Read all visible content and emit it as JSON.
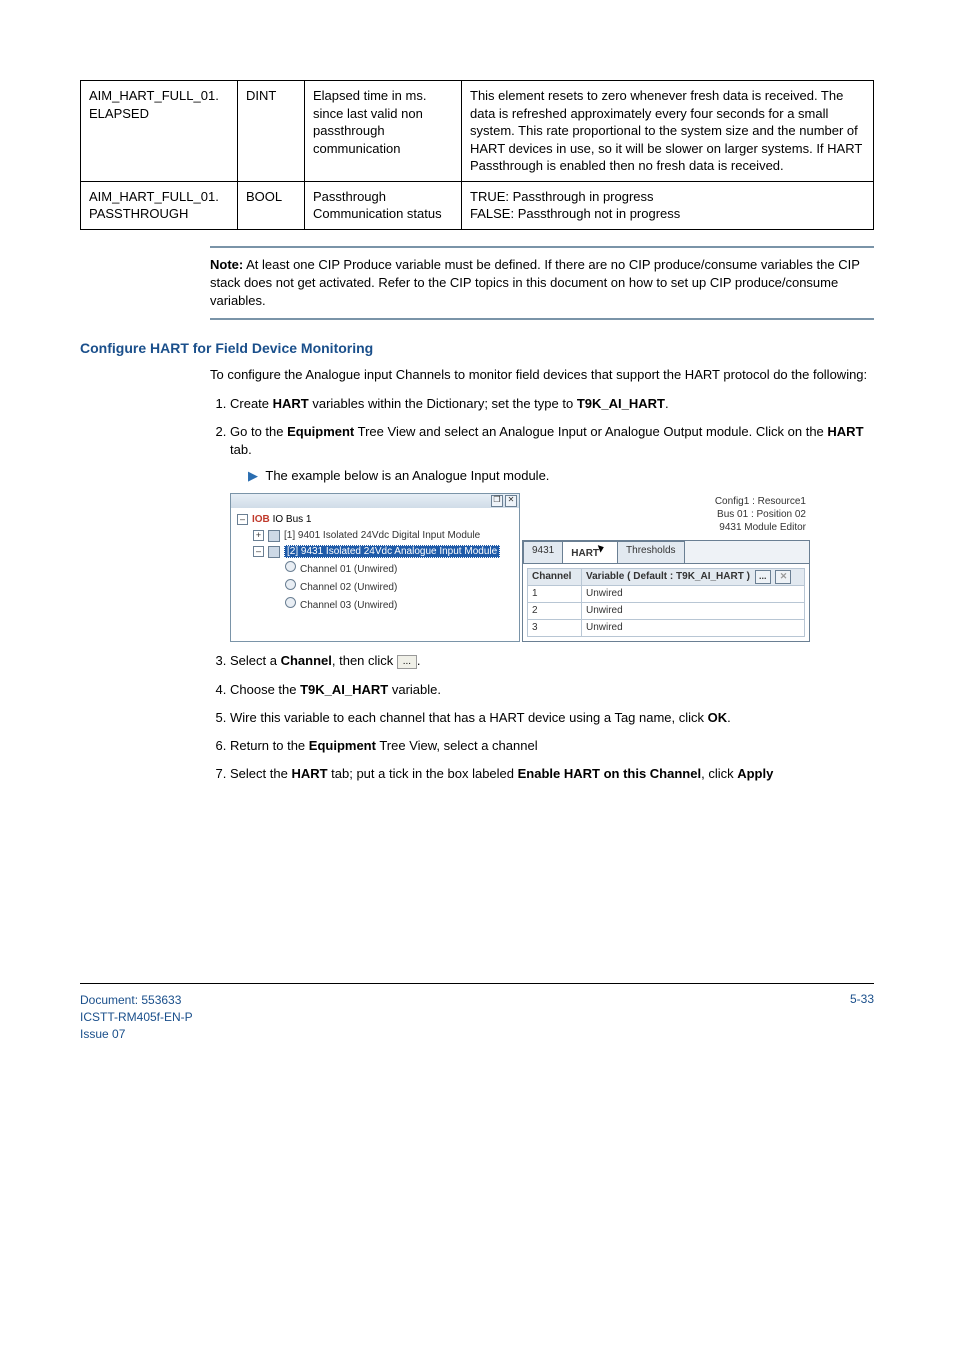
{
  "table": {
    "rows": [
      {
        "name": "AIM_HART_FULL_01.\nELAPSED",
        "type": "DINT",
        "desc": "Elapsed time in ms. since last valid non passthrough communication",
        "detail": "This element resets to zero whenever fresh data is received. The data is refreshed approximately every four seconds for a small system. This rate proportional to the system size and the number of HART devices in use, so it will be slower on larger systems. If HART Passthrough is enabled then no fresh data is received."
      },
      {
        "name": "AIM_HART_FULL_01.\nPASSTHROUGH",
        "type": "BOOL",
        "desc": "Passthrough Communication status",
        "detail": "TRUE: Passthrough in progress\nFALSE: Passthrough not in progress"
      }
    ]
  },
  "note": {
    "label": "Note:",
    "text": " At least one CIP Produce variable must be defined. If there are no CIP produce/consume variables the CIP stack does not get activated. Refer to the CIP topics in this document on how to set up CIP produce/consume variables."
  },
  "section_heading": "Configure HART for Field Device Monitoring",
  "para1": "To configure the Analogue input Channels to monitor field devices that support the HART protocol do the following:",
  "steps12": [
    "Create <b>HART</b> variables within the Dictionary; set the type to <b>T9K_AI_HART</b>.",
    "Go to the <b>Equipment</b> Tree View and select an Analogue Input or Analogue Output module. Click on the <b>HART</b> tab."
  ],
  "sub_bullet": "The example below is an Analogue Input module.",
  "ui": {
    "tree": {
      "root_iob": "IOB",
      "root_bus": "IO Bus 1",
      "item1": "[1] 9401 Isolated 24Vdc Digital Input Module",
      "item2": "[2] 9431 Isolated 24Vdc Analogue Input Module",
      "ch1": "Channel 01 (Unwired)",
      "ch2": "Channel 02 (Unwired)",
      "ch3": "Channel 03 (Unwired)"
    },
    "right": {
      "line1": "Config1 : Resource1",
      "line2": "Bus 01 : Position 02",
      "line3": "9431 Module Editor",
      "tab1": "9431",
      "tab2": "HART",
      "tab3": "Thresholds",
      "col_channel": "Channel",
      "col_variable": "Variable ( Default : T9K_AI_HART )",
      "rows": [
        {
          "ch": "1",
          "val": "Unwired"
        },
        {
          "ch": "2",
          "val": "Unwired"
        },
        {
          "ch": "3",
          "val": "Unwired"
        }
      ],
      "btn_ell": "...",
      "btn_x": "✕"
    }
  },
  "step3_a": "Select a ",
  "step3_b": "Channel",
  "step3_c": ", then  click ",
  "step3_btn": "...",
  "step3_d": ".",
  "step4": "Choose the <b>T9K_AI_HART</b> variable.",
  "step5": "Wire this variable to each channel that has a HART device using a Tag name, click <b>OK</b>.",
  "step6": "Return to the <b>Equipment</b> Tree View, select a channel",
  "step7": "Select the <b>HART</b> tab; put a tick in the box labeled <b>Enable HART on this Channel</b>, click <b>Apply</b>",
  "footer": {
    "doc": "Document: 553633",
    "code": "ICSTT-RM405f-EN-P",
    "issue": "Issue 07",
    "page": "5-33"
  }
}
